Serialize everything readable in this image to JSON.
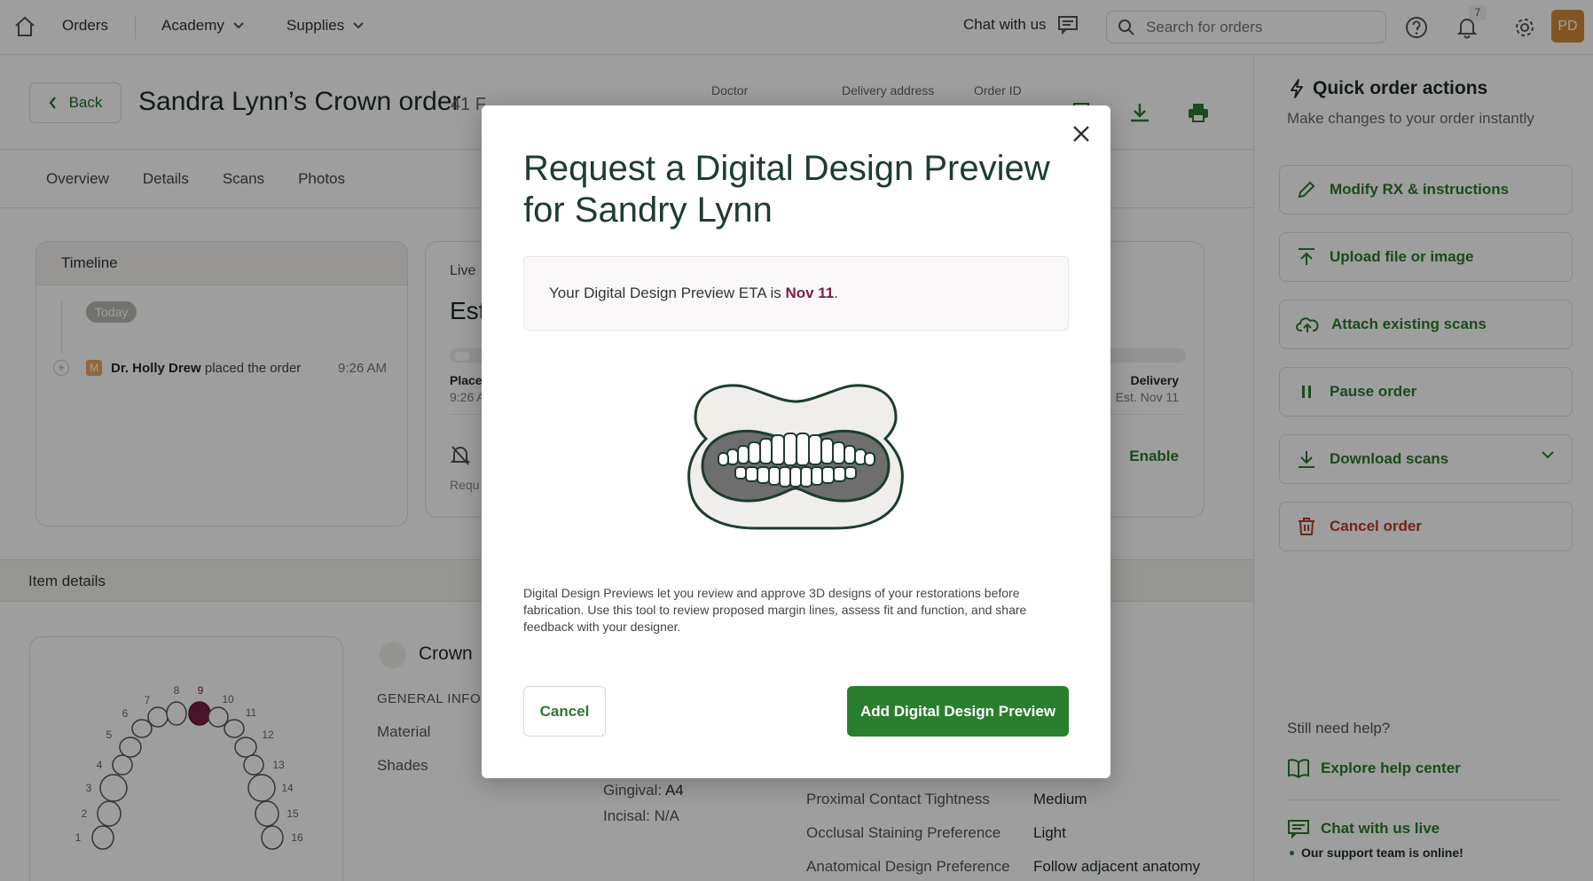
{
  "nav": {
    "orders": "Orders",
    "academy": "Academy",
    "supplies": "Supplies",
    "chat": "Chat with us",
    "search_placeholder": "Search for orders",
    "notif_count": "7",
    "avatar": "PD"
  },
  "order": {
    "back": "Back",
    "title": "Sandra Lynn’s Crown order",
    "subtitle": "41 F",
    "meta": {
      "doctor": "Doctor",
      "address": "Delivery address",
      "order_id": "Order ID"
    }
  },
  "tabs": [
    "Overview",
    "Details",
    "Scans",
    "Photos"
  ],
  "timeline": {
    "header": "Timeline",
    "today": "Today",
    "avatar_letter": "M",
    "actor": "Dr. Holly Drew",
    "action": "placed the order",
    "time": "9:26 AM"
  },
  "live": {
    "label": "Live",
    "est": "Est",
    "placed": "Place",
    "placed_time": "9:26 A",
    "delivery": "Delivery",
    "delivery_est": "Est. Nov 11",
    "request": "Requ",
    "enable": "Enable"
  },
  "item_details": {
    "header": "Item details",
    "crown": "Crown",
    "general_info": "GENERAL INFO",
    "material": "Material",
    "shades": "Shades",
    "gingival_label": "Gingival:",
    "gingival_val": "A4",
    "incisal": "Incisal: N/A",
    "rows": [
      {
        "label": "Proximal Contact Tightness",
        "value": "Medium"
      },
      {
        "label": "Occlusal Staining Preference",
        "value": "Light"
      },
      {
        "label": "Anatomical Design Preference",
        "value": "Follow adjacent anatomy"
      }
    ],
    "tooth_numbers": [
      "1",
      "2",
      "3",
      "4",
      "5",
      "6",
      "7",
      "8",
      "9",
      "10",
      "11",
      "12",
      "13",
      "14",
      "15",
      "16"
    ],
    "selected_tooth": "9"
  },
  "quick_actions": {
    "title": "Quick order actions",
    "subtitle": "Make changes to your order instantly",
    "buttons": [
      {
        "label": "Modify RX & instructions"
      },
      {
        "label": "Upload file or image"
      },
      {
        "label": "Attach existing scans"
      },
      {
        "label": "Pause order"
      },
      {
        "label": "Download scans"
      },
      {
        "label": "Cancel order"
      }
    ],
    "help_title": "Still need help?",
    "help_center": "Explore help center",
    "chat_live": "Chat with us live",
    "online": "Our support team is online!"
  },
  "modal": {
    "title": "Request a Digital Design Preview for Sandry Lynn",
    "eta_prefix": "Your Digital Design Preview ETA is ",
    "eta_date": "Nov 11",
    "eta_suffix": ".",
    "description": "Digital Design Previews let you review and approve 3D designs of your restorations before fabrication. Use this tool to review proposed margin lines, assess fit and function, and share feedback with your designer.",
    "cancel": "Cancel",
    "add": "Add Digital Design Preview"
  },
  "colors": {
    "brand_green": "#2a7f2e",
    "eta_date": "#7a1f45",
    "danger": "#c0392b",
    "selected_tooth": "#7a1f45"
  }
}
